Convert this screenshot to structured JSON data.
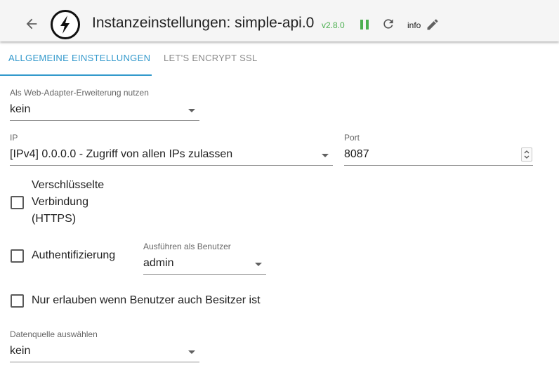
{
  "header": {
    "title": "Instanzeinstellungen: simple-api.0",
    "version": "v2.8.0",
    "loglevel": "info",
    "colors": {
      "version": "#4caf50",
      "pause": "#4caf50",
      "accent": "#3399cc"
    },
    "icons": [
      "arrow-back-icon",
      "adapter-logo-icon",
      "pause-icon",
      "reload-icon",
      "edit-icon"
    ]
  },
  "tabs": [
    {
      "label": "ALLGEMEINE EINSTELLUNGEN",
      "active": true
    },
    {
      "label": "LET'S ENCRYPT SSL",
      "active": false
    }
  ],
  "form": {
    "web_adapter": {
      "label": "Als Web-Adapter-Erweiterung nutzen",
      "value": "kein"
    },
    "ip": {
      "label": "IP",
      "value": "[IPv4] 0.0.0.0 - Zugriff von allen IPs zulassen"
    },
    "port": {
      "label": "Port",
      "value": "8087"
    },
    "secure": {
      "label_lines": [
        "Verschlüsselte",
        "Verbindung",
        "(HTTPS)"
      ],
      "checked": false
    },
    "auth": {
      "label": "Authentifizierung",
      "checked": false
    },
    "run_as": {
      "label": "Ausführen als Benutzer",
      "value": "admin"
    },
    "only_owner": {
      "label": "Nur erlauben wenn Benutzer auch Besitzer ist",
      "checked": false
    },
    "datasource": {
      "label": "Datenquelle auswählen",
      "value": "kein"
    }
  }
}
